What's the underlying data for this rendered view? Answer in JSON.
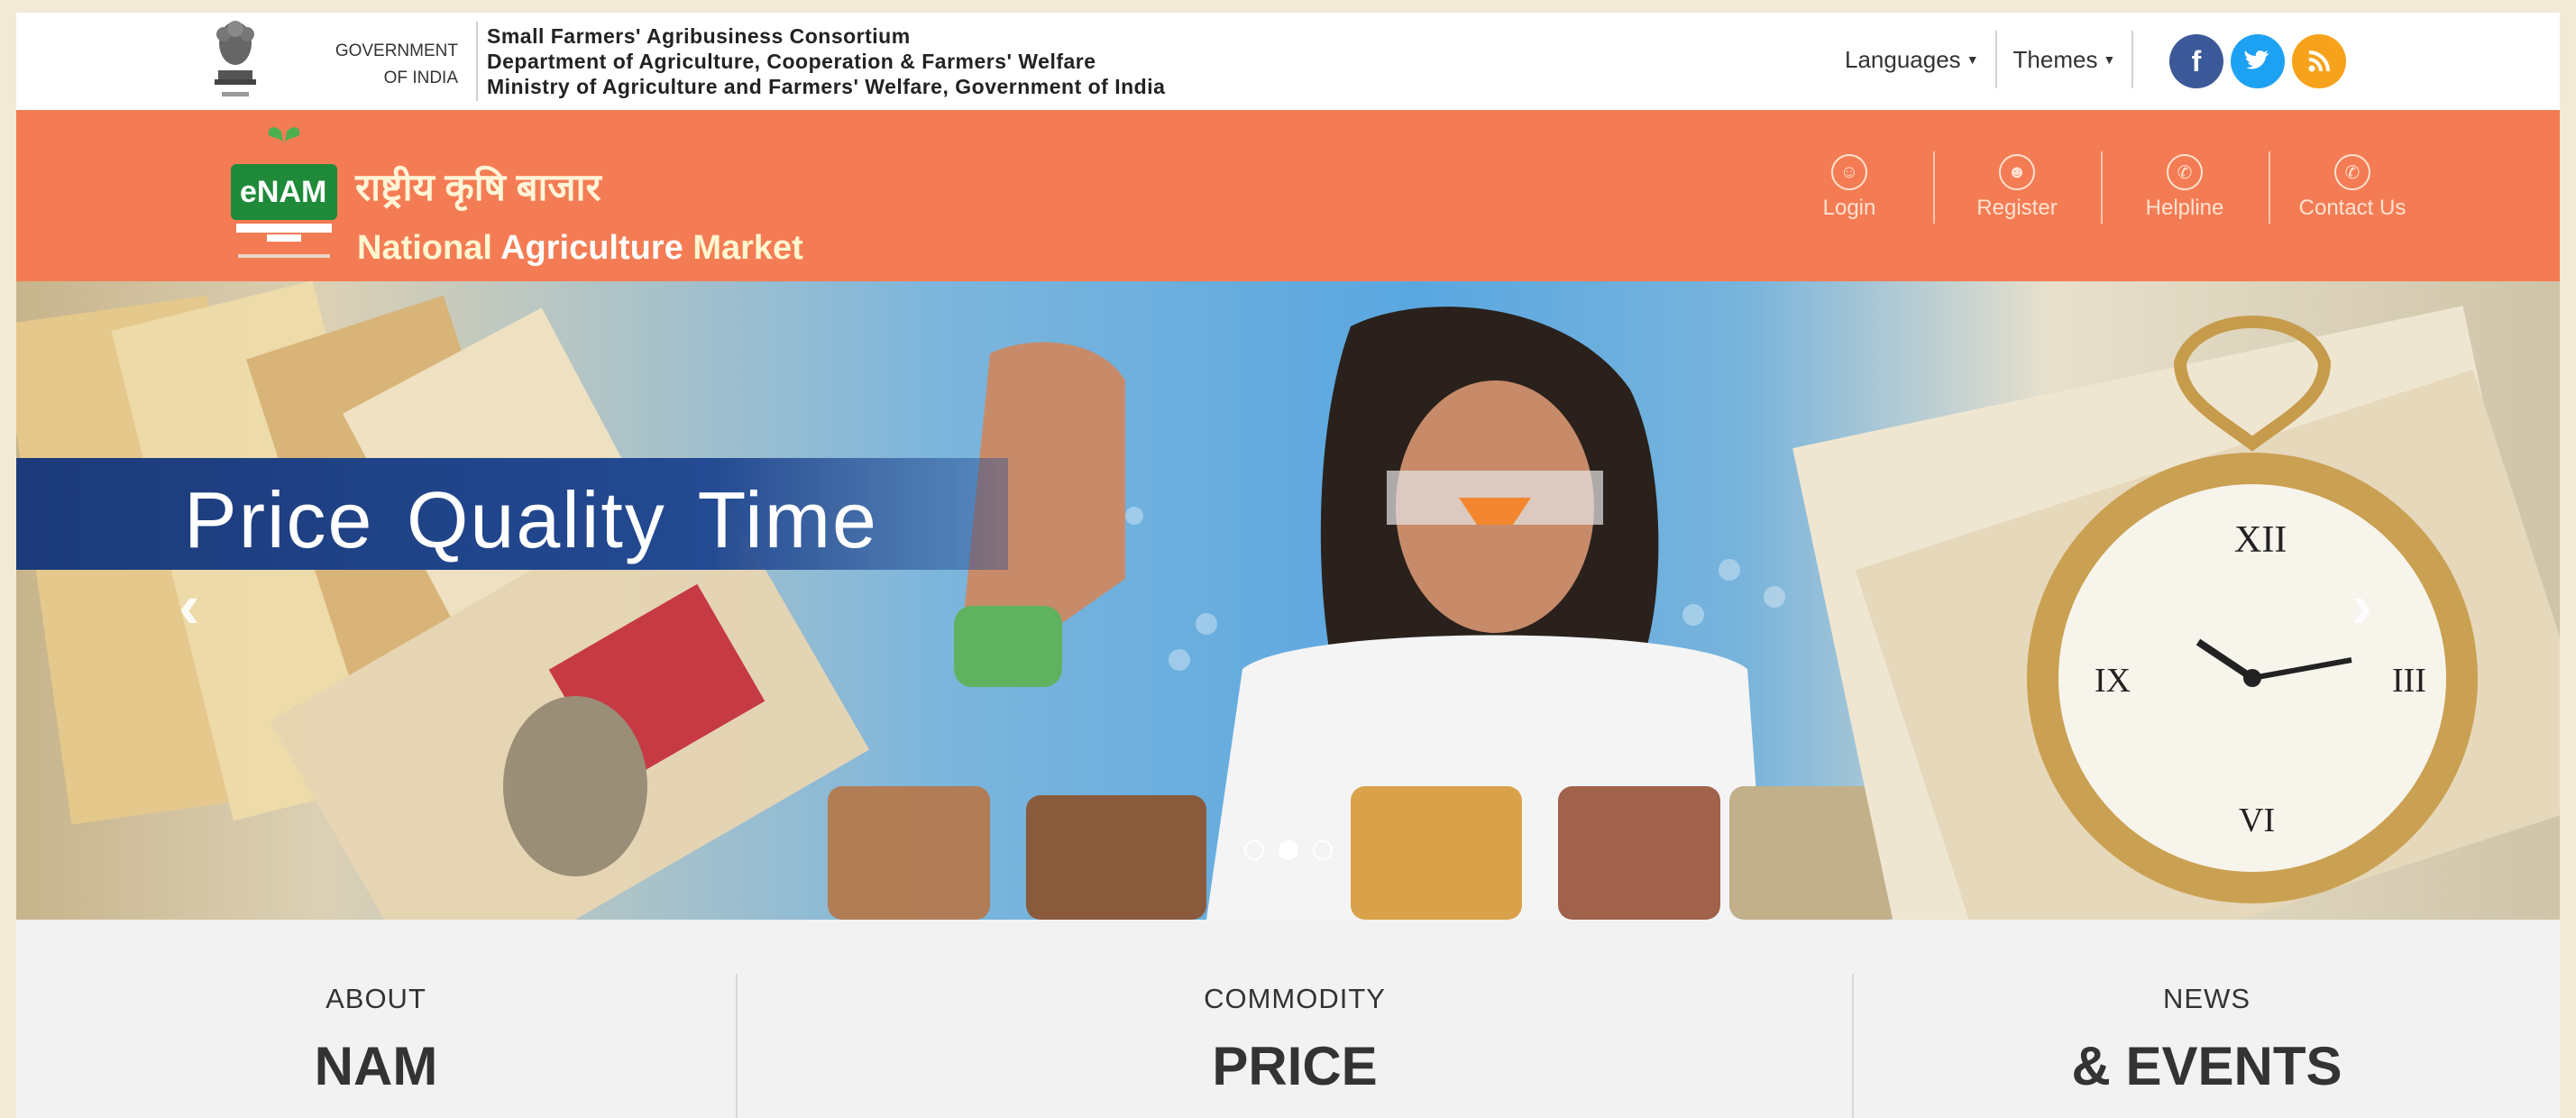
{
  "gov": {
    "line1": "GOVERNMENT",
    "line2": "OF INDIA"
  },
  "ministry": {
    "line1": "Small Farmers' Agribusiness Consortium",
    "line2": "Department of Agriculture, Cooperation & Farmers' Welfare",
    "line3": "Ministry of Agriculture and Farmers' Welfare, Government of India"
  },
  "utility": {
    "languages": "Languages",
    "themes": "Themes"
  },
  "social": {
    "facebook": "f",
    "twitter": "t",
    "rss": "r",
    "facebook_color": "#3b5998",
    "twitter_color": "#1da1f2",
    "rss_color": "#f7a21b"
  },
  "brand": {
    "logo_text": "eNAM",
    "hindi": "राष्ट्रीय कृषि बाजार",
    "en_word1": "National",
    "en_word2": "Agriculture",
    "en_word3": "Market",
    "header_color": "#f47c55"
  },
  "nav": [
    {
      "label": "Login",
      "icon": "user-icon"
    },
    {
      "label": "Register",
      "icon": "register-icon"
    },
    {
      "label": "Helpline",
      "icon": "phone-icon"
    },
    {
      "label": "Contact Us",
      "icon": "contact-icon"
    }
  ],
  "banner": {
    "caption": "Price  Quality  Time",
    "slide_count": 3,
    "active_slide": 2
  },
  "tiles": [
    {
      "sub": "ABOUT",
      "big": "NAM"
    },
    {
      "sub": "COMMODITY",
      "big": "PRICE"
    },
    {
      "sub": "NEWS",
      "big": "& EVENTS"
    }
  ]
}
